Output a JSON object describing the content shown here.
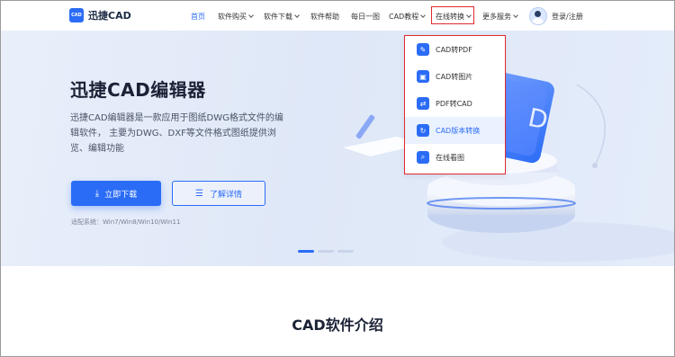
{
  "header": {
    "logo_text": "迅捷CAD",
    "logo_mark": "CAD",
    "nav": [
      {
        "label": "首页",
        "active": true,
        "chevron": false
      },
      {
        "label": "软件购买",
        "chevron": true
      },
      {
        "label": "软件下载",
        "chevron": true
      },
      {
        "label": "软件帮助",
        "chevron": false
      },
      {
        "label": "每日一图",
        "chevron": false
      },
      {
        "label": "CAD教程",
        "chevron": true
      },
      {
        "label": "在线转换",
        "chevron": true
      },
      {
        "label": "更多服务",
        "chevron": true
      }
    ],
    "login_label": "登录/注册"
  },
  "hero": {
    "title": "迅捷CAD编辑器",
    "description": "迅捷CAD编辑器是一款应用于图纸DWG格式文件的编辑软件， 主要为DWG、DXF等文件格式图纸提供浏览、编辑功能",
    "download_button": "立即下载",
    "details_button": "了解详情",
    "systems": "适配系统：Win7/Win8/Win10/Win11",
    "carousel_active_index": 0
  },
  "online_convert_menu": [
    {
      "label": "CAD转PDF",
      "icon": "pdf-convert-icon",
      "glyph": "✎",
      "highlighted": false
    },
    {
      "label": "CAD转图片",
      "icon": "image-convert-icon",
      "glyph": "▣",
      "highlighted": false
    },
    {
      "label": "PDF转CAD",
      "icon": "pdf-to-cad-icon",
      "glyph": "⇄",
      "highlighted": false
    },
    {
      "label": "CAD版本转换",
      "icon": "version-convert-icon",
      "glyph": "↻",
      "highlighted": true
    },
    {
      "label": "在线看图",
      "icon": "view-drawing-icon",
      "glyph": "⌕",
      "highlighted": false
    }
  ],
  "section": {
    "title": "CAD软件介绍"
  },
  "colors": {
    "accent": "#2b6cf6",
    "highlight_border": "#e0292f",
    "hero_bg": "#e4ecfa"
  }
}
